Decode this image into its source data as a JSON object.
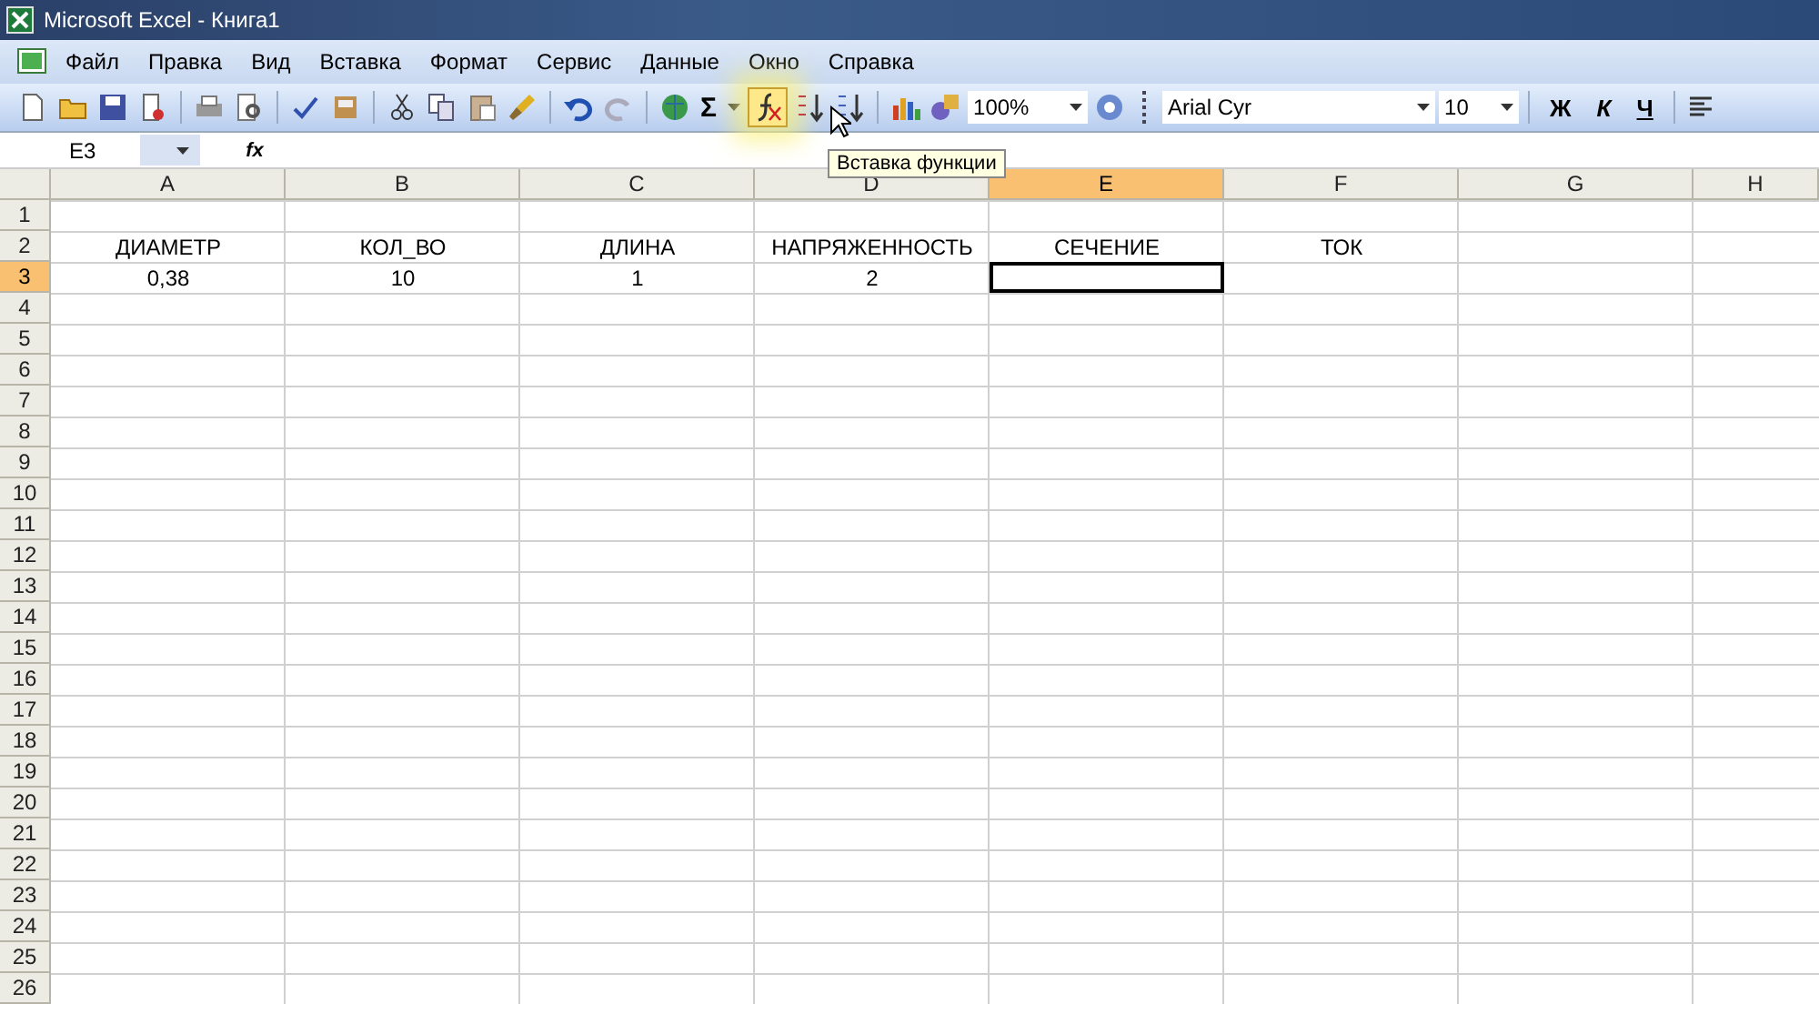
{
  "window": {
    "title": "Microsoft Excel - Книга1"
  },
  "menu": [
    "Файл",
    "Правка",
    "Вид",
    "Вставка",
    "Формат",
    "Сервис",
    "Данные",
    "Окно",
    "Справка"
  ],
  "toolbar": {
    "autosum": "Σ",
    "zoom": "100%",
    "font": "Arial Cyr",
    "font_size": "10",
    "bold": "Ж",
    "italic": "К",
    "underline": "Ч",
    "tooltip": "Вставка функции"
  },
  "formula_bar": {
    "name_box": "E3",
    "fx": "fx"
  },
  "columns": [
    {
      "label": "A",
      "selected": false
    },
    {
      "label": "B",
      "selected": false
    },
    {
      "label": "C",
      "selected": false
    },
    {
      "label": "D",
      "selected": false
    },
    {
      "label": "E",
      "selected": true
    },
    {
      "label": "F",
      "selected": false
    },
    {
      "label": "G",
      "selected": false
    },
    {
      "label": "H",
      "selected": false
    }
  ],
  "rows": [
    {
      "label": "1",
      "selected": false,
      "cells": []
    },
    {
      "label": "2",
      "selected": false,
      "cells": [
        "ДИАМЕТР",
        "КОЛ_ВО",
        "ДЛИНА",
        "НАПРЯЖЕННОСТЬ",
        "СЕЧЕНИЕ",
        "ТОК"
      ]
    },
    {
      "label": "3",
      "selected": true,
      "cells": [
        "0,38",
        "10",
        "1",
        "2"
      ]
    },
    {
      "label": "4",
      "selected": false,
      "cells": []
    },
    {
      "label": "5",
      "selected": false,
      "cells": []
    },
    {
      "label": "6",
      "selected": false,
      "cells": []
    },
    {
      "label": "7",
      "selected": false,
      "cells": []
    },
    {
      "label": "8",
      "selected": false,
      "cells": []
    },
    {
      "label": "9",
      "selected": false,
      "cells": []
    },
    {
      "label": "10",
      "selected": false,
      "cells": []
    },
    {
      "label": "11",
      "selected": false,
      "cells": []
    },
    {
      "label": "12",
      "selected": false,
      "cells": []
    },
    {
      "label": "13",
      "selected": false,
      "cells": []
    },
    {
      "label": "14",
      "selected": false,
      "cells": []
    },
    {
      "label": "15",
      "selected": false,
      "cells": []
    },
    {
      "label": "16",
      "selected": false,
      "cells": []
    },
    {
      "label": "17",
      "selected": false,
      "cells": []
    },
    {
      "label": "18",
      "selected": false,
      "cells": []
    },
    {
      "label": "19",
      "selected": false,
      "cells": []
    },
    {
      "label": "20",
      "selected": false,
      "cells": []
    },
    {
      "label": "21",
      "selected": false,
      "cells": []
    },
    {
      "label": "22",
      "selected": false,
      "cells": []
    },
    {
      "label": "23",
      "selected": false,
      "cells": []
    },
    {
      "label": "24",
      "selected": false,
      "cells": []
    },
    {
      "label": "25",
      "selected": false,
      "cells": []
    },
    {
      "label": "26",
      "selected": false,
      "cells": []
    }
  ]
}
